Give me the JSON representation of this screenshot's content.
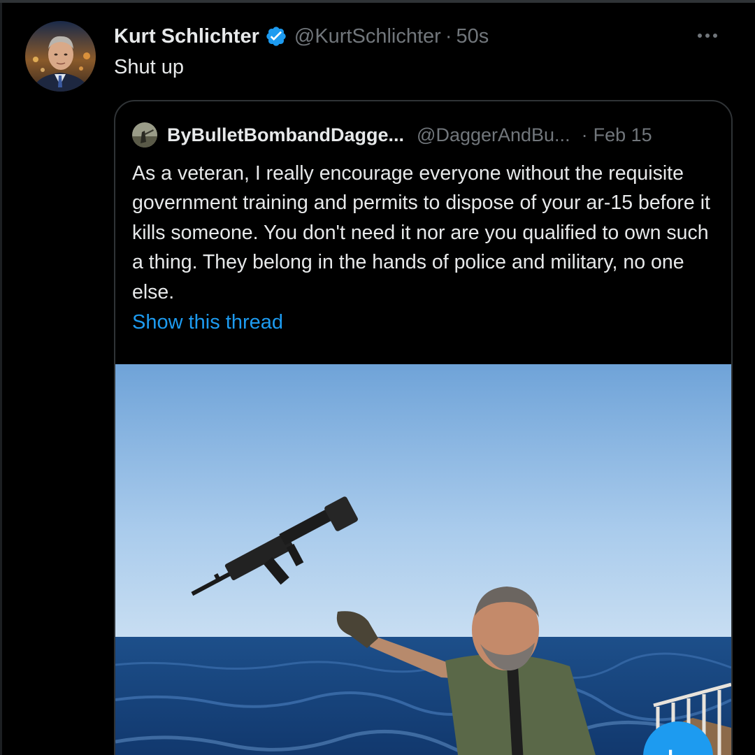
{
  "tweet": {
    "display_name": "Kurt Schlichter",
    "handle": "@KurtSchlichter",
    "separator": "·",
    "time": "50s",
    "text": "Shut up"
  },
  "quoted_tweet": {
    "display_name": "ByBulletBombandDagge...",
    "handle": "@DaggerAndBu...",
    "separator": "·",
    "date": "Feb 15",
    "text": "As a veteran, I really encourage everyone without the requisite government training and permits to dispose of your ar-15 before it kills someone. You don't need it nor are you qualified to own such a thing. They belong in the hands of police and military, no one else.",
    "show_thread_label": "Show this thread"
  },
  "icons": {
    "verified": "verified-badge-icon",
    "more": "more-options-icon",
    "compose": "compose-fab-icon"
  },
  "colors": {
    "background": "#000000",
    "primary_text": "#e7e9ea",
    "secondary_text": "#71767b",
    "link": "#1d9bf0",
    "border": "#2f3336",
    "verified": "#1d9bf0"
  }
}
